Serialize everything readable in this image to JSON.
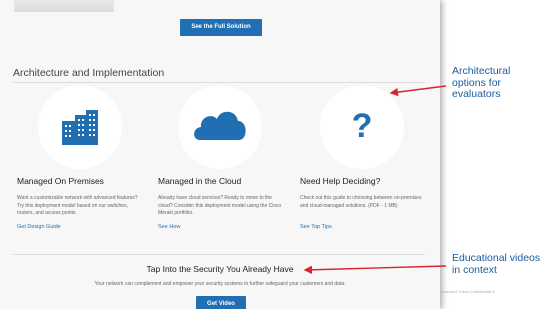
{
  "buttons": {
    "full_solution": "See the Full Solution",
    "get_video": "Get Video"
  },
  "section": {
    "title": "Architecture and Implementation"
  },
  "columns": [
    {
      "title": "Managed On Premises",
      "desc": "Want a customizable network with advanced features? Try this deployment model based on our switches, routers, and access points.",
      "link": "Get Design Guide",
      "icon": "buildings-icon"
    },
    {
      "title": "Managed in the Cloud",
      "desc": "Already have cloud services? Ready to move to the cloud? Consider this deployment model using the Cisco Meraki portfolio.",
      "link": "See How",
      "icon": "cloud-icon"
    },
    {
      "title": "Need Help Deciding?",
      "desc": "Check out this guide to choosing between on-premises and cloud-managed solutions. (PDF - 1 MB)",
      "link": "See Top Tips",
      "icon": "question-icon"
    }
  ],
  "security": {
    "title": "Tap Into the Security You Already Have",
    "desc": "Your network can complement and empower your security systems to further safeguard your customers and data."
  },
  "callouts": {
    "architectural": "Architectural options for evaluators",
    "educational": "Educational videos in context"
  },
  "footer": {
    "text": "reserved.   Cisco Confidential        5"
  },
  "colors": {
    "accent": "#1f6fb2",
    "arrow": "#d9232d",
    "callout": "#1b5c9e"
  }
}
